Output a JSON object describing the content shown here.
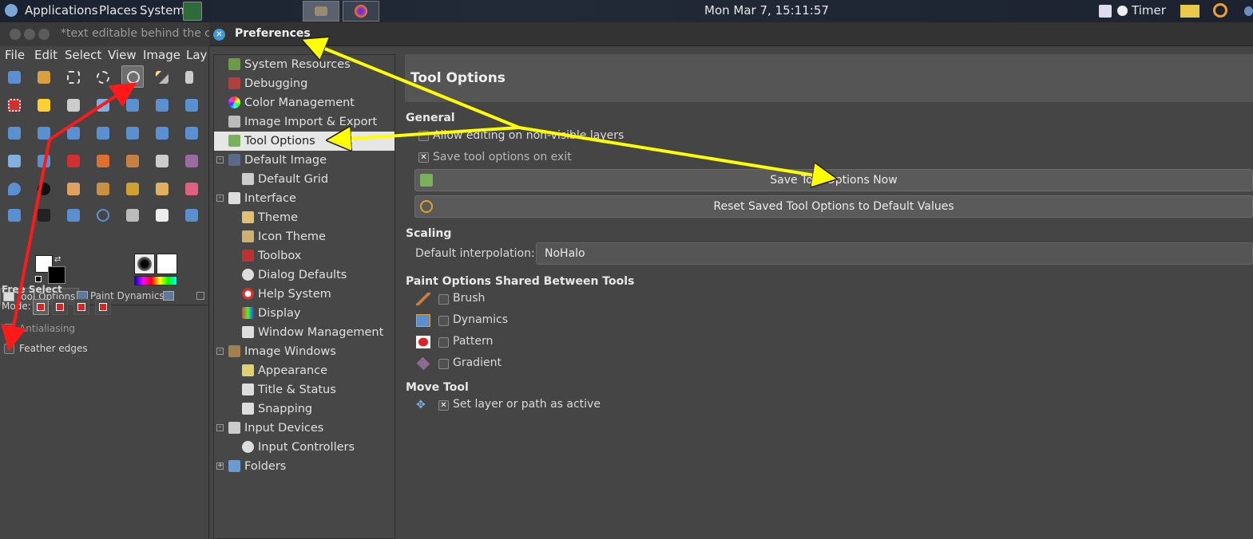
{
  "top_panel": {
    "applications": "Applications",
    "places": "Places",
    "system": "System",
    "clock": "Mon Mar  7, 15:11:57",
    "timer": "Timer"
  },
  "gimp": {
    "window_title": "*text editable behind the c",
    "menu": [
      "File",
      "Edit",
      "Select",
      "View",
      "Image",
      "Lay"
    ],
    "dock_tabs": [
      "Tool Options",
      "Paint Dynamics"
    ],
    "tool_name": "Free Select",
    "mode_label": "Mode:",
    "antialiasing": "Antialiasing",
    "feather_edges": "Feather edges"
  },
  "preferences": {
    "title": "Preferences",
    "tree": [
      {
        "label": "System Resources",
        "indent": 0
      },
      {
        "label": "Debugging",
        "indent": 0
      },
      {
        "label": "Color Management",
        "indent": 0
      },
      {
        "label": "Image Import & Export",
        "indent": 0
      },
      {
        "label": "Tool Options",
        "indent": 0,
        "selected": true
      },
      {
        "label": "Default Image",
        "indent": 0,
        "expander": "-"
      },
      {
        "label": "Default Grid",
        "indent": 1
      },
      {
        "label": "Interface",
        "indent": 0,
        "expander": "-"
      },
      {
        "label": "Theme",
        "indent": 1
      },
      {
        "label": "Icon Theme",
        "indent": 1
      },
      {
        "label": "Toolbox",
        "indent": 1
      },
      {
        "label": "Dialog Defaults",
        "indent": 1
      },
      {
        "label": "Help System",
        "indent": 1
      },
      {
        "label": "Display",
        "indent": 1
      },
      {
        "label": "Window Management",
        "indent": 1
      },
      {
        "label": "Image Windows",
        "indent": 0,
        "expander": "-"
      },
      {
        "label": "Appearance",
        "indent": 1
      },
      {
        "label": "Title & Status",
        "indent": 1
      },
      {
        "label": "Snapping",
        "indent": 1
      },
      {
        "label": "Input Devices",
        "indent": 0,
        "expander": "-"
      },
      {
        "label": "Input Controllers",
        "indent": 1
      },
      {
        "label": "Folders",
        "indent": 0,
        "expander": "+"
      }
    ],
    "page_title": "Tool Options",
    "general": {
      "heading": "General",
      "allow_editing": "Allow editing on non-visible layers",
      "save_on_exit": "Save tool options on exit",
      "save_now_button": "Save Tool Options Now",
      "reset_button": "Reset Saved Tool Options to Default Values"
    },
    "scaling": {
      "heading": "Scaling",
      "interp_label": "Default interpolation:",
      "interp_value": "NoHalo"
    },
    "paint_options": {
      "heading": "Paint Options Shared Between Tools",
      "items": [
        "Brush",
        "Dynamics",
        "Pattern",
        "Gradient"
      ]
    },
    "move_tool": {
      "heading": "Move Tool",
      "set_active": "Set layer or path as active"
    }
  },
  "colors": {
    "annotation_yellow": "#ffff00",
    "annotation_red": "#ff1a1a",
    "selection": "#e6e6e6"
  }
}
